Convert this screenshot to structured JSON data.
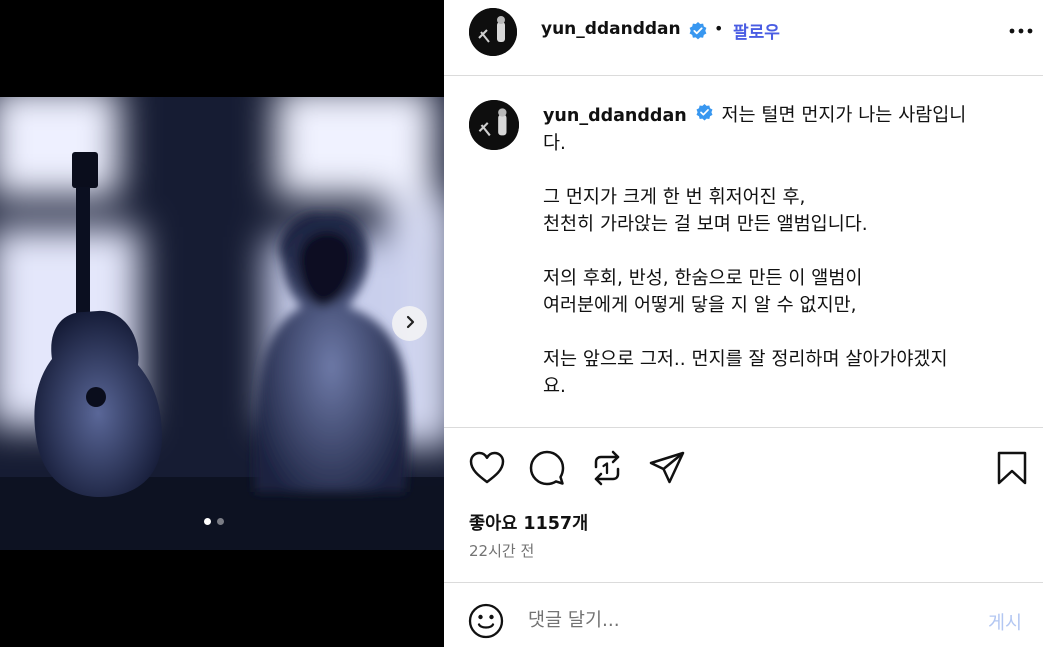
{
  "post": {
    "username": "yun_ddanddan",
    "follow_label": "팔로우",
    "separator": "•",
    "caption_lines": [
      "저는 털면 먼지가 나는 사람입니",
      "다.",
      "",
      "그 먼지가 크게 한 번 휘저어진 후,",
      "천천히 가라앉는 걸 보며 만든 앨범입니다.",
      "",
      "저의 후회, 반성, 한숨으로 만든 이 앨범이",
      "여러분에게 어떻게 닿을 지 알 수 없지만,",
      "",
      "저는 앞으로 그저.. 먼지를 잘 정리하며 살아가야겠지",
      "요."
    ],
    "likes_text": "좋아요 1157개",
    "time_text": "22시간 전",
    "comment_placeholder": "댓글 달기...",
    "post_button_label": "게시",
    "carousel": {
      "slide_count": 2,
      "active_index": 0
    }
  },
  "icons": {
    "verified": "verified-badge-icon",
    "more": "more-options-icon",
    "like": "heart-icon",
    "comment": "comment-icon",
    "repost": "repost-icon",
    "share": "share-icon",
    "save": "bookmark-icon",
    "emoji": "emoji-icon",
    "next": "chevron-right-icon"
  },
  "colors": {
    "follow": "#4a5de3",
    "verified": "#3897f0",
    "post_button": "#b3c7f2",
    "muted_text": "#737373",
    "divider": "#dbdbdb"
  }
}
